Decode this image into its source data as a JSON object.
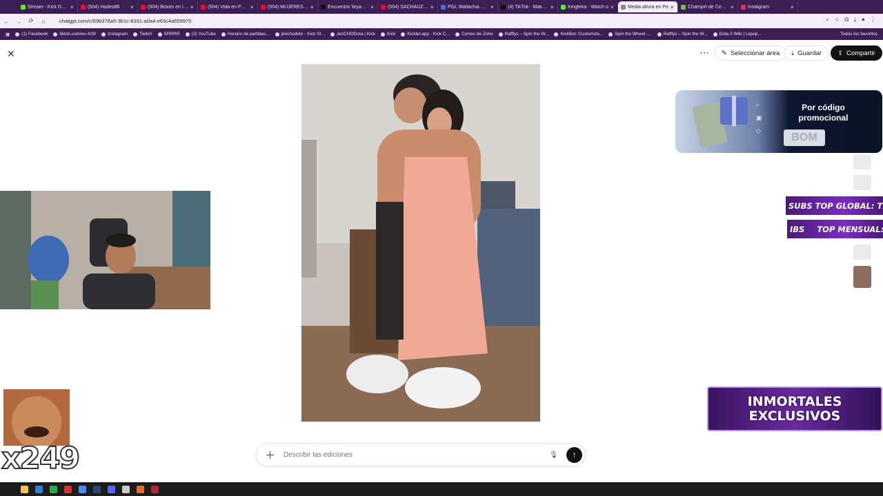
{
  "browser": {
    "tabs": [
      {
        "title": "Stream - Kick Dash",
        "color": "#53fc18"
      },
      {
        "title": "(504) Hades86",
        "color": "#ff0033"
      },
      {
        "title": "(504) Boxeo en la F",
        "color": "#ff0033"
      },
      {
        "title": "(504) Vida en Polon",
        "color": "#ff0033"
      },
      {
        "title": "(504) MUJERES DE",
        "color": "#ff0033"
      },
      {
        "title": "Encuentra 'bryan sa",
        "color": "#111111"
      },
      {
        "title": "(504) SACHAUZUM",
        "color": "#ff0033"
      },
      {
        "title": "PGL Wallachia Seas",
        "color": "#5a6bd6"
      },
      {
        "title": "(4) TikTok - Make Y",
        "color": "#111111"
      },
      {
        "title": "Kingteka - Watch o",
        "color": "#53fc18"
      },
      {
        "title": "Media altura en Po",
        "color": "#888888",
        "active": true
      },
      {
        "title": "Champiñ de Cebolla",
        "color": "#7cc24a"
      },
      {
        "title": "Instagram",
        "color": "#e1306c"
      }
    ],
    "url": "chatgpt.com/c/69b376a5-3b1c-8331-a0a4-e65c4a559970",
    "bookmarks": [
      "(1) Facebook",
      "tiktok.com/es-419/",
      "Instagram",
      "Twitch",
      "SRRRR",
      "(2) YouTube",
      "Horario de partidas...",
      "jerichodoto - Kick St...",
      "JeriCHODota | Kick",
      "Kick",
      "Kicklet.app - Kick C...",
      "Correo de Zoho",
      "Rafflys – Spin the W...",
      "KickBot: Customiza...",
      "Spin the Wheel -...",
      "Rafflys – Spin the W...",
      "Dota 2 Wiki | Liquip..."
    ],
    "bookmarks_right": "Todos los favoritos"
  },
  "editor": {
    "close_icon": "close-icon",
    "more_icon": "more-icon",
    "select_area_label": "Seleccionar área",
    "save_label": "Guardar",
    "share_label": "Compartir",
    "prompt_placeholder": "Describir las ediciones"
  },
  "overlays": {
    "promo_title": "Por código promocional",
    "promo_code": "BOM",
    "banner1_left": "SUBS TOP GLOBAL: TRAG",
    "banner2_left": "IBS",
    "banner2_right": "TOP MENSUAL: RI",
    "inmortales": "INMORTALES EXCLUSIVOS",
    "counter": "x249"
  }
}
